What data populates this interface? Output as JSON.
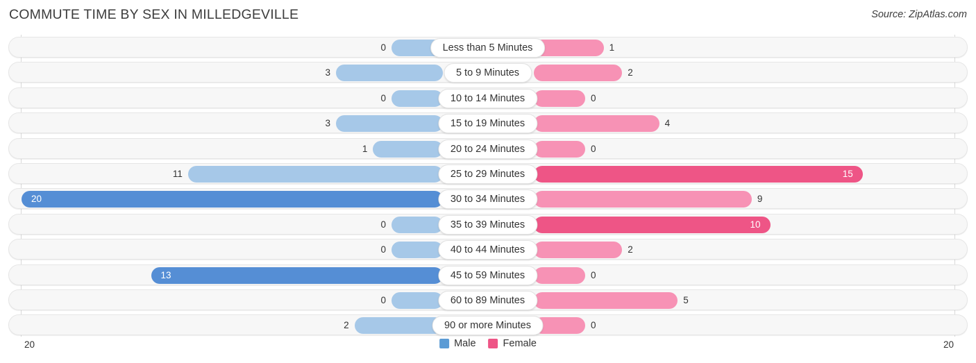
{
  "header": {
    "title": "COMMUTE TIME BY SEX IN MILLEDGEVILLE",
    "source": "Source: ZipAtlas.com"
  },
  "axis": {
    "left_label": "20",
    "right_label": "20"
  },
  "legend": {
    "items": [
      {
        "label": "Male",
        "color": "#5b9bd5"
      },
      {
        "label": "Female",
        "color": "#ee5586"
      }
    ]
  },
  "colors": {
    "male": "#a6c8e8",
    "male_peak": "#558ed5",
    "female": "#f792b5",
    "female_peak": "#ee5586",
    "row_track": "#f7f7f7",
    "gridline": "#d9d9d9"
  },
  "chart_data": {
    "type": "bar",
    "title": "COMMUTE TIME BY SEX IN MILLEDGEVILLE",
    "subtitle": "Source: ZipAtlas.com",
    "orientation": "horizontal-diverging",
    "xlabel": "",
    "ylabel": "",
    "xlim": [
      20,
      20
    ],
    "grid": true,
    "legend_position": "bottom-center",
    "categories": [
      "Less than 5 Minutes",
      "5 to 9 Minutes",
      "10 to 14 Minutes",
      "15 to 19 Minutes",
      "20 to 24 Minutes",
      "25 to 29 Minutes",
      "30 to 34 Minutes",
      "35 to 39 Minutes",
      "40 to 44 Minutes",
      "45 to 59 Minutes",
      "60 to 89 Minutes",
      "90 or more Minutes"
    ],
    "series": [
      {
        "name": "Male",
        "values": [
          0,
          3,
          0,
          3,
          1,
          11,
          20,
          0,
          0,
          13,
          0,
          2
        ]
      },
      {
        "name": "Female",
        "values": [
          1,
          2,
          0,
          4,
          0,
          15,
          9,
          10,
          2,
          0,
          5,
          0
        ]
      }
    ],
    "labels": {
      "male": [
        "0",
        "3",
        "0",
        "3",
        "1",
        "11",
        "20",
        "0",
        "0",
        "13",
        "0",
        "2"
      ],
      "female": [
        "1",
        "2",
        "0",
        "4",
        "0",
        "15",
        "9",
        "10",
        "2",
        "0",
        "5",
        "0"
      ]
    },
    "max_value": 20
  },
  "rows": [
    {
      "label": "Less than 5 Minutes",
      "male": 0,
      "female": 1,
      "male_text": "0",
      "female_text": "1",
      "male_peak": false,
      "female_peak": false
    },
    {
      "label": "5 to 9 Minutes",
      "male": 3,
      "female": 2,
      "male_text": "3",
      "female_text": "2",
      "male_peak": false,
      "female_peak": false
    },
    {
      "label": "10 to 14 Minutes",
      "male": 0,
      "female": 0,
      "male_text": "0",
      "female_text": "0",
      "male_peak": false,
      "female_peak": false
    },
    {
      "label": "15 to 19 Minutes",
      "male": 3,
      "female": 4,
      "male_text": "3",
      "female_text": "4",
      "male_peak": false,
      "female_peak": false
    },
    {
      "label": "20 to 24 Minutes",
      "male": 1,
      "female": 0,
      "male_text": "1",
      "female_text": "0",
      "male_peak": false,
      "female_peak": false
    },
    {
      "label": "25 to 29 Minutes",
      "male": 11,
      "female": 15,
      "male_text": "11",
      "female_text": "15",
      "male_peak": false,
      "female_peak": true
    },
    {
      "label": "30 to 34 Minutes",
      "male": 20,
      "female": 9,
      "male_text": "20",
      "female_text": "9",
      "male_peak": true,
      "female_peak": false
    },
    {
      "label": "35 to 39 Minutes",
      "male": 0,
      "female": 10,
      "male_text": "0",
      "female_text": "10",
      "male_peak": false,
      "female_peak": true
    },
    {
      "label": "40 to 44 Minutes",
      "male": 0,
      "female": 2,
      "male_text": "0",
      "female_text": "2",
      "male_peak": false,
      "female_peak": false
    },
    {
      "label": "45 to 59 Minutes",
      "male": 13,
      "female": 0,
      "male_text": "13",
      "female_text": "0",
      "male_peak": true,
      "female_peak": false
    },
    {
      "label": "60 to 89 Minutes",
      "male": 0,
      "female": 5,
      "male_text": "0",
      "female_text": "5",
      "male_peak": false,
      "female_peak": false
    },
    {
      "label": "90 or more Minutes",
      "male": 2,
      "female": 0,
      "male_text": "2",
      "female_text": "0",
      "male_peak": false,
      "female_peak": false
    }
  ]
}
